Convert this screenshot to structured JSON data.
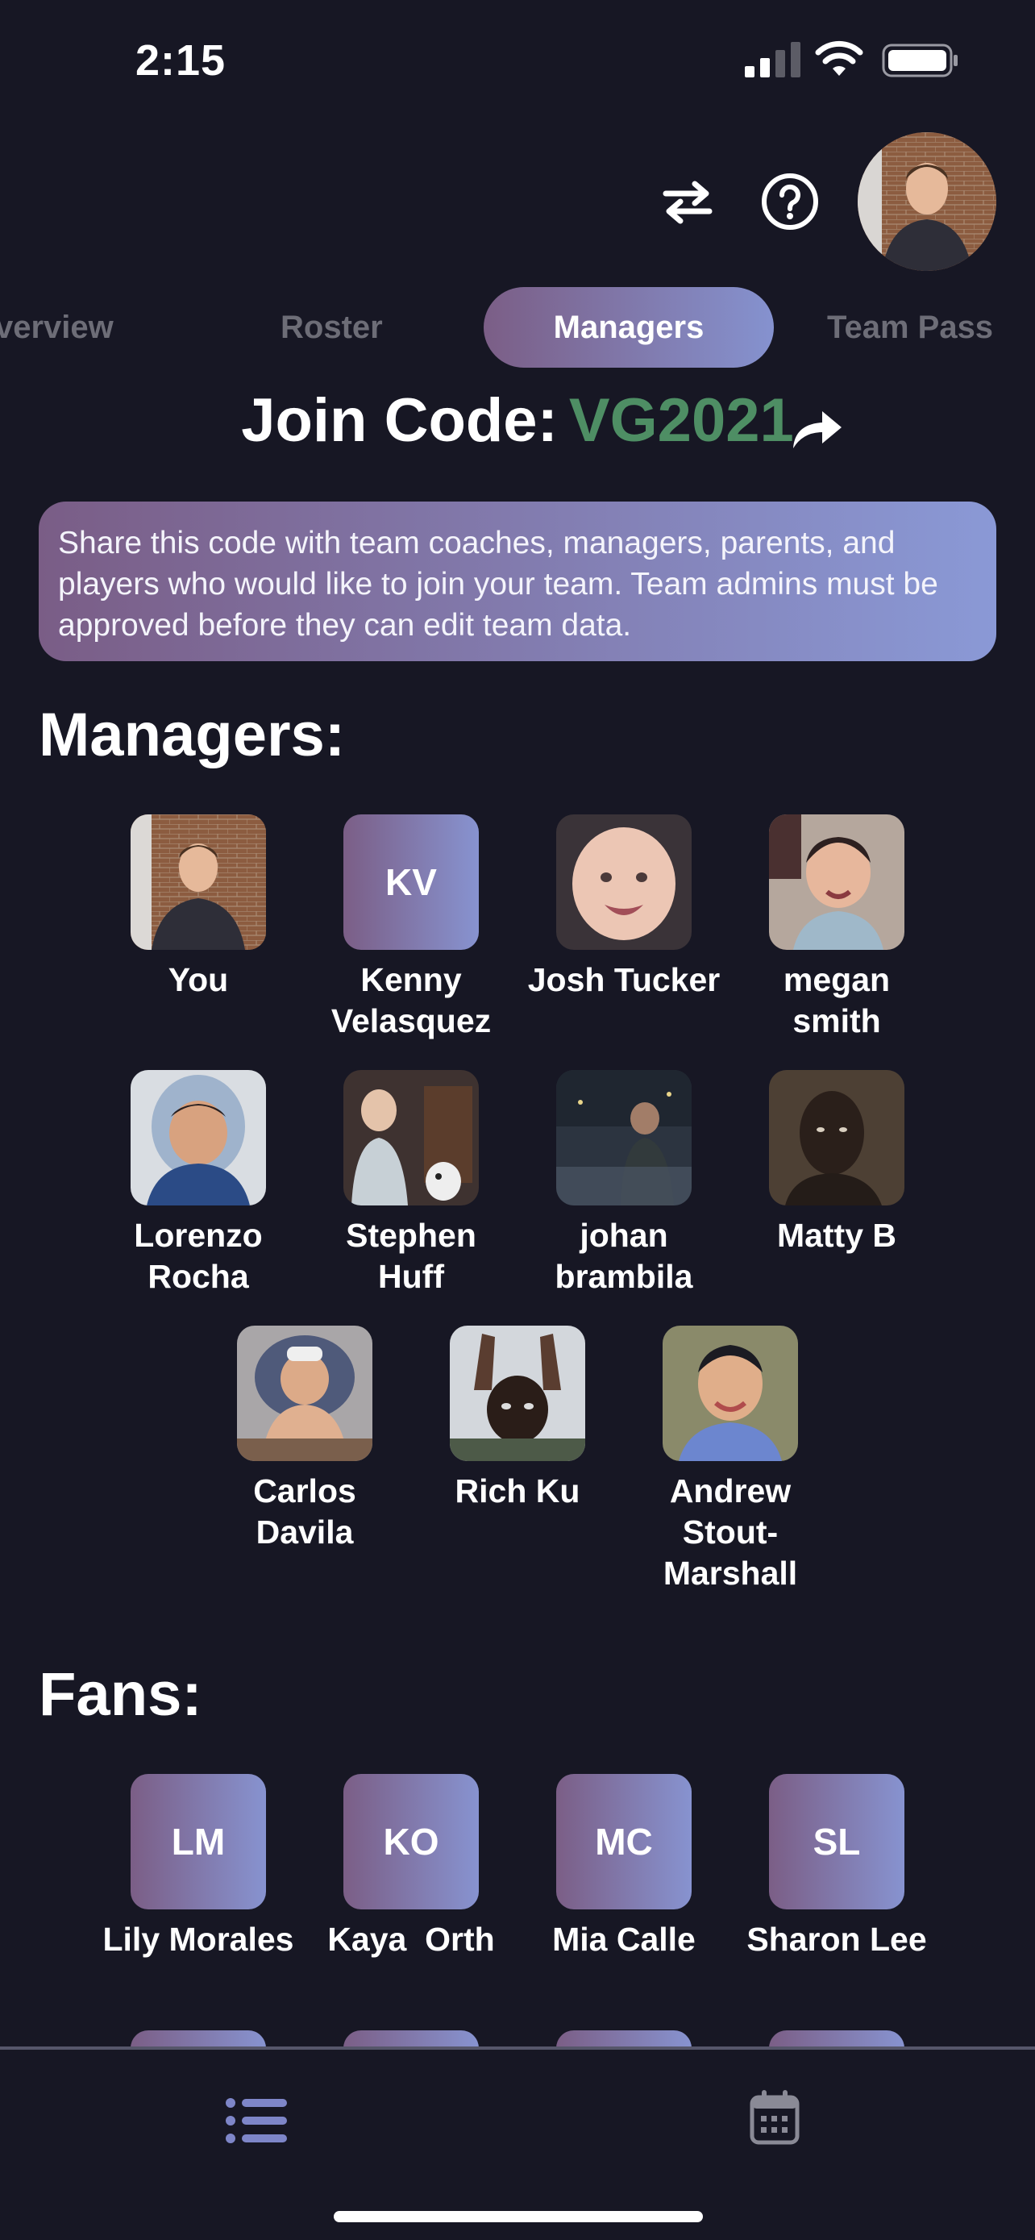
{
  "status_bar": {
    "time": "2:15"
  },
  "tabs": [
    {
      "label": "verview"
    },
    {
      "label": "Roster"
    },
    {
      "label": "Managers"
    },
    {
      "label": "Team Pass"
    }
  ],
  "join": {
    "label": "Join Code:",
    "code": "VG2021"
  },
  "info_text": "Share this code with team coaches, managers, parents, and players who would like to join your team. Team admins must be approved before they can edit team data.",
  "managers": {
    "title": "Managers:",
    "people": [
      {
        "name": "You",
        "initials": ""
      },
      {
        "name": "Kenny Velasquez",
        "initials": "KV"
      },
      {
        "name": "Josh Tucker",
        "initials": ""
      },
      {
        "name": "megan smith",
        "initials": ""
      },
      {
        "name": "Lorenzo Rocha",
        "initials": ""
      },
      {
        "name": "Stephen Huff",
        "initials": ""
      },
      {
        "name": "johan brambila",
        "initials": ""
      },
      {
        "name": "Matty B",
        "initials": ""
      },
      {
        "name": "Carlos Davila",
        "initials": ""
      },
      {
        "name": "Rich Ku",
        "initials": ""
      },
      {
        "name": "Andrew Stout-Marshall",
        "initials": ""
      }
    ]
  },
  "fans": {
    "title": "Fans:",
    "people": [
      {
        "name": "Lily Morales",
        "initials": "LM"
      },
      {
        "name": "Kaya  Orth",
        "initials": "KO"
      },
      {
        "name": "Mia Calle",
        "initials": "MC"
      },
      {
        "name": "Sharon Lee",
        "initials": "SL"
      }
    ]
  },
  "colors": {
    "background": "#171724",
    "join_code": "#4e8e64",
    "gradient_start": "#7b5e86",
    "gradient_end": "#8793d0",
    "inactive_tab": "#6d6d77"
  },
  "icons": {
    "swap": "swap-arrows-icon",
    "help": "help-icon",
    "share": "share-arrow-icon",
    "list": "list-icon",
    "calendar": "calendar-icon"
  }
}
